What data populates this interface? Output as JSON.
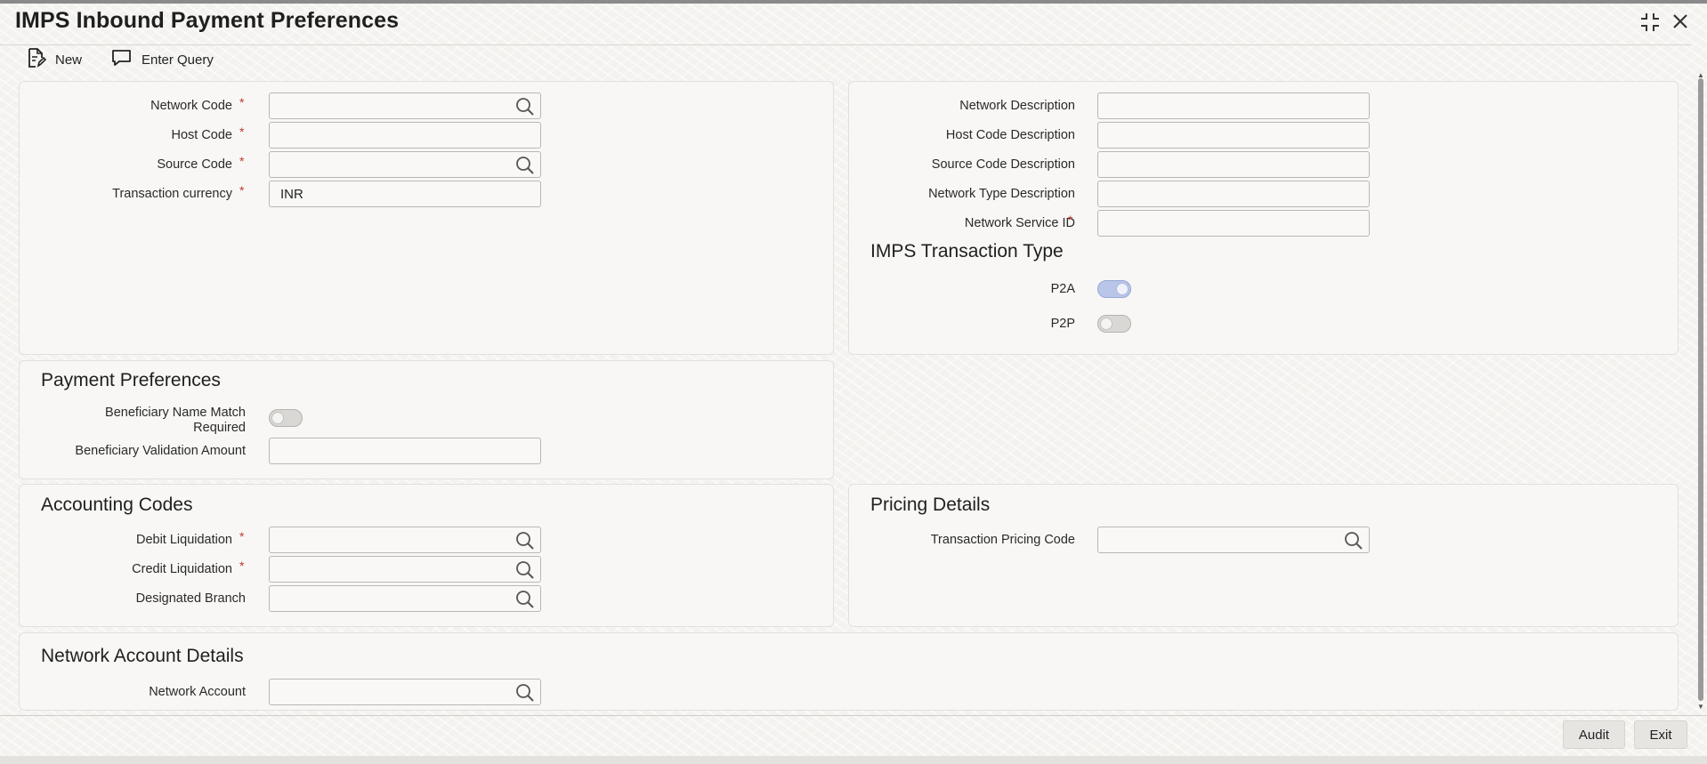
{
  "window": {
    "title": "IMPS Inbound Payment Preferences"
  },
  "toolbar": {
    "new_label": "New",
    "enter_query_label": "Enter Query"
  },
  "main": {
    "network_code": {
      "label": "Network Code",
      "required": "*",
      "value": ""
    },
    "host_code": {
      "label": "Host Code",
      "required": "*",
      "value": ""
    },
    "source_code": {
      "label": "Source Code",
      "required": "*",
      "value": ""
    },
    "transaction_currency": {
      "label": "Transaction currency",
      "required": "*",
      "value": "INR"
    },
    "network_description": {
      "label": "Network Description",
      "value": ""
    },
    "host_code_description": {
      "label": "Host Code Description",
      "value": ""
    },
    "source_code_description": {
      "label": "Source Code Description",
      "value": ""
    },
    "network_type_description": {
      "label": "Network Type Description",
      "value": ""
    },
    "network_service_id": {
      "label": "Network Service ID",
      "required": "*",
      "value": ""
    }
  },
  "imps_transaction_type": {
    "title": "IMPS Transaction Type",
    "p2a": {
      "label": "P2A",
      "on": true
    },
    "p2p": {
      "label": "P2P",
      "on": false
    }
  },
  "payment_preferences": {
    "title": "Payment Preferences",
    "beneficiary_name_match": {
      "label_line1": "Beneficiary Name Match",
      "label_line2": "Required",
      "on": false
    },
    "beneficiary_validation_amount": {
      "label": "Beneficiary Validation Amount",
      "value": ""
    }
  },
  "accounting_codes": {
    "title": "Accounting Codes",
    "debit_liquidation": {
      "label": "Debit Liquidation",
      "required": "*",
      "value": ""
    },
    "credit_liquidation": {
      "label": "Credit Liquidation",
      "required": "*",
      "value": ""
    },
    "designated_branch": {
      "label": "Designated Branch",
      "value": ""
    }
  },
  "pricing_details": {
    "title": "Pricing Details",
    "transaction_pricing_code": {
      "label": "Transaction Pricing Code",
      "value": ""
    }
  },
  "network_account_details": {
    "title": "Network Account Details",
    "network_account": {
      "label": "Network Account",
      "value": ""
    }
  },
  "footer": {
    "audit_label": "Audit",
    "exit_label": "Exit"
  },
  "colors": {
    "required": "#c0392b",
    "toggle_on": "#b9c6ea",
    "panel_bg": "#f8f7f5"
  },
  "icons": {
    "new": "new-document-icon",
    "enter_query": "chat-bubble-icon",
    "lookup": "search-icon",
    "maximize": "maximize-icon",
    "close": "close-icon"
  }
}
